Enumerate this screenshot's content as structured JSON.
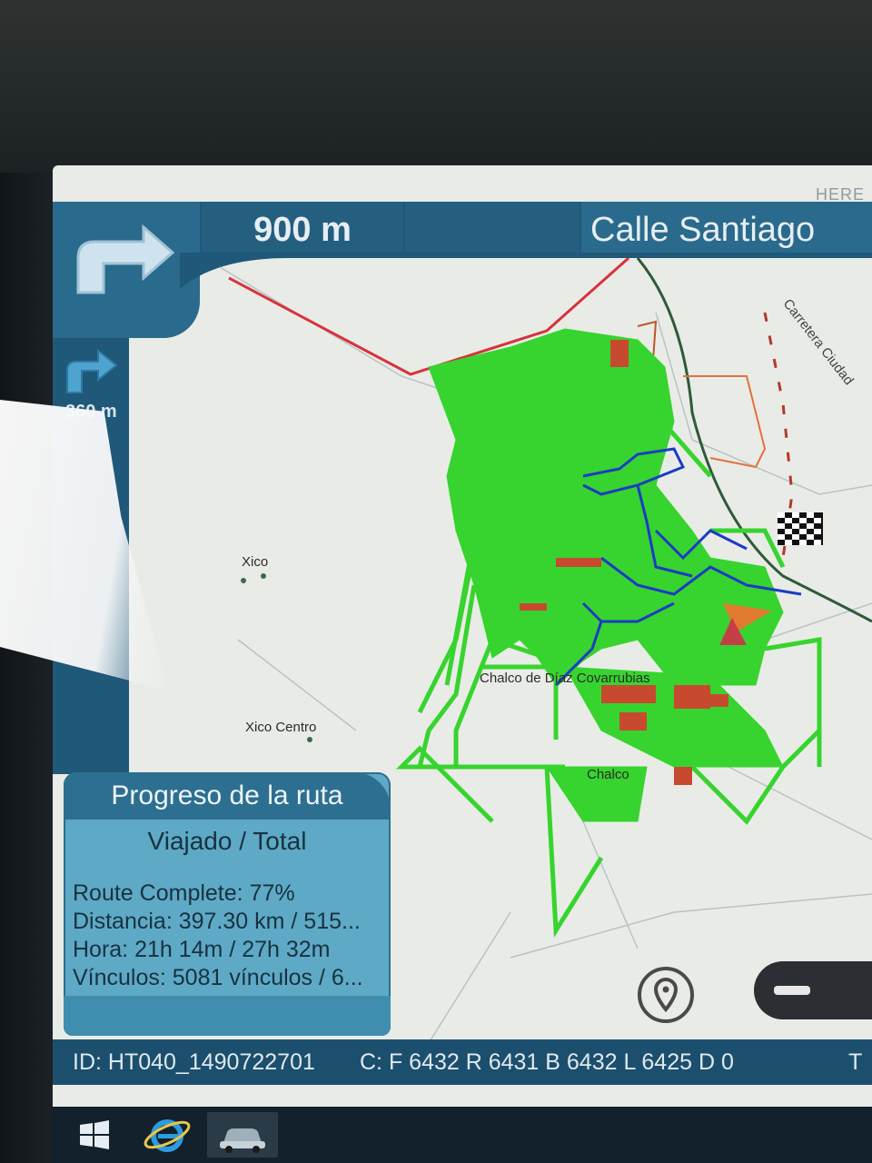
{
  "brand": "HERE",
  "navigation": {
    "next_maneuver_distance": "900 m",
    "street_name": "Calle Santiago",
    "following_maneuver_distance": "360 m",
    "maneuver_icon": "turn-right-arrow-icon"
  },
  "map": {
    "labels": {
      "xico": "Xico",
      "xico_centro": "Xico Centro",
      "chalco_diaz": "Chalco de Díaz Covarrubias",
      "chalco": "Chalco",
      "carretera": "Carretera Ciudad"
    },
    "colors": {
      "traveled": "#37d42f",
      "planned": "#1b3cc4",
      "boundary": "#d8323c",
      "road_orange": "#e4713e",
      "rail": "#2f5a3a"
    },
    "icons": [
      "destination-flag-icon",
      "vehicle-position-icon",
      "locate-icon",
      "zoom-out-icon"
    ]
  },
  "progress": {
    "title": "Progreso de la ruta",
    "subtitle": "Viajado / Total",
    "rows": [
      "Route Complete: 77%",
      "Distancia: 397.30 km / 515...",
      "Hora: 21h 14m / 27h 32m",
      "Vínculos: 5081 vínculos / 6..."
    ],
    "percent_complete": 77
  },
  "status": {
    "id": "ID: HT040_1490722701",
    "counters": "C: F 6432 R 6431 B 6432 L 6425 D 0",
    "trailing": "T"
  },
  "taskbar": {
    "items": [
      "windows-start-icon",
      "internet-explorer-icon",
      "navigation-app-icon"
    ]
  }
}
